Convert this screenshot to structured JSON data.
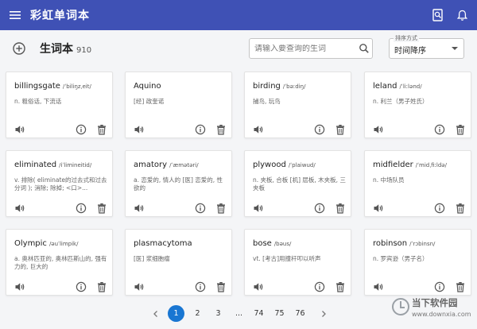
{
  "app": {
    "title": "彩虹单词本"
  },
  "toolbar": {
    "heading": "生词本",
    "count": "910"
  },
  "search": {
    "placeholder": "请输入要查询的生词"
  },
  "sort": {
    "label": "排序方式",
    "value": "时间降序"
  },
  "cards": [
    {
      "word": "billingsgate",
      "phonetic": "/ˈbiliŋzˌeit/",
      "definition": "n. 粗俗话, 下流话"
    },
    {
      "word": "Aquino",
      "phonetic": "",
      "definition": "[经] 政奎诺"
    },
    {
      "word": "birding",
      "phonetic": "/ˈbəːdiŋ/",
      "definition": "捕鸟, 玩鸟"
    },
    {
      "word": "leland",
      "phonetic": "/ˈliːlənd/",
      "definition": "n. 利兰（男子姓氏）"
    },
    {
      "word": "eliminated",
      "phonetic": "/iˈlimineitid/",
      "definition": "v. 排除( eliminate的过去式和过去分词 ); 消除; 除掉; <口>..."
    },
    {
      "word": "amatory",
      "phonetic": "/ˈæmətəri/",
      "definition": "a. 恋爱的, 情人的 [医] 恋爱的, 性欲的"
    },
    {
      "word": "plywood",
      "phonetic": "/ˈplaiwud/",
      "definition": "n. 夹板, 合板 [机] 层板, 木夹板, 三夹板"
    },
    {
      "word": "midfielder",
      "phonetic": "/ˈmidˌfiːldə/",
      "definition": "n. 中场队员"
    },
    {
      "word": "Olympic",
      "phonetic": "/əuˈlimpik/",
      "definition": "a. 奥林匹亚的, 奥林匹斯山的, 强有力的, 巨大的"
    },
    {
      "word": "plasmacytoma",
      "phonetic": "",
      "definition": "[医] 浆细胞瘤"
    },
    {
      "word": "bose",
      "phonetic": "/bəus/",
      "definition": "vt. [考古]用撞杆叩以听声"
    },
    {
      "word": "robinson",
      "phonetic": "/ˈrɔbinsn/",
      "definition": "n. 罗宾逊（男子名）"
    }
  ],
  "pagination": {
    "pages": [
      "1",
      "2",
      "3",
      "...",
      "74",
      "75",
      "76"
    ],
    "active": "1"
  },
  "watermark": {
    "line1": "当下软件园",
    "line2": "www.downxia.com"
  },
  "colors": {
    "appbar": "#3f51b5",
    "active_page": "#1976d2"
  },
  "icons": {
    "menu": "menu-icon",
    "wordbook": "wordbook-search-icon",
    "notifications": "bell-icon",
    "add": "add-circle-icon",
    "search": "search-icon",
    "speak": "speaker-icon",
    "info": "info-icon",
    "delete": "trash-icon",
    "prev": "chevron-left-icon",
    "next": "chevron-right-icon"
  }
}
